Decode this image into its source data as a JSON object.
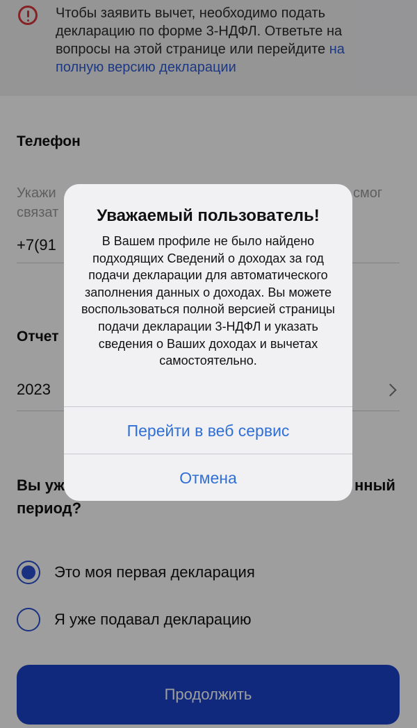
{
  "banner": {
    "text": "Чтобы заявить вычет, необходимо подать декларацию по форме 3-НДФЛ. Ответьте на вопросы на этой странице или перейдите ",
    "link": "на полную версию декларации"
  },
  "phone": {
    "label": "Телефон",
    "hint_left": "Укажи",
    "hint_left2": "связат",
    "hint_right": "смог",
    "value": "+7(91"
  },
  "period": {
    "label": "Отчет",
    "value": "2023"
  },
  "question": {
    "text_left": "Вы уж",
    "text_right": "нный",
    "text_line2": "период?"
  },
  "radios": [
    {
      "label": "Это моя первая декларация",
      "checked": true
    },
    {
      "label": "Я уже подавал декларацию",
      "checked": false
    }
  ],
  "continue_label": "Продолжить",
  "dialog": {
    "title": "Уважаемый пользователь!",
    "message": "В Вашем профиле не было найдено подходящих Сведений о доходах за год подачи декларации для автоматического заполнения данных о доходах. Вы можете воспользоваться полной версией страницы подачи декларации 3-НДФЛ и указать сведения о Ваших доходах и вычетах самостоятельно.",
    "primary": "Перейти в веб сервис",
    "cancel": "Отмена"
  },
  "colors": {
    "accent": "#1a43c9",
    "error": "#d9383a",
    "link": "#2f6fd6"
  }
}
